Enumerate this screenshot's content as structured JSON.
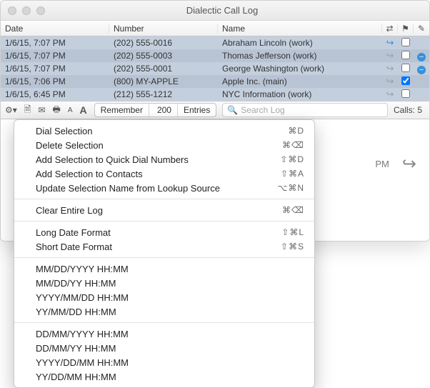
{
  "window": {
    "title": "Dialectic Call Log"
  },
  "columns": {
    "date": "Date",
    "number": "Number",
    "name": "Name"
  },
  "rows": [
    {
      "date": "1/6/15, 7:07 PM",
      "number": "(202) 555-0016",
      "name": "Abraham Lincoln (work)",
      "dir": "in",
      "flag": false,
      "minus": false
    },
    {
      "date": "1/6/15, 7:07 PM",
      "number": "(202) 555-0003",
      "name": "Thomas Jefferson (work)",
      "dir": "out",
      "flag": false,
      "minus": true
    },
    {
      "date": "1/6/15, 7:07 PM",
      "number": "(202) 555-0001",
      "name": "George Washington (work)",
      "dir": "out",
      "flag": false,
      "minus": true
    },
    {
      "date": "1/6/15, 7:06 PM",
      "number": "(800) MY-APPLE",
      "name": "Apple Inc. (main)",
      "dir": "out",
      "flag": true,
      "minus": false
    },
    {
      "date": "1/6/15, 6:45 PM",
      "number": "(212) 555-1212",
      "name": "NYC Information (work)",
      "dir": "out",
      "flag": false,
      "minus": false
    }
  ],
  "toolbar": {
    "remember_label": "Remember",
    "remember_count": "200",
    "entries_label": "Entries",
    "search_placeholder": "Search Log",
    "calls_label": "Calls: 5"
  },
  "preview": {
    "text": "PM"
  },
  "menu": {
    "g1": [
      {
        "label": "Dial Selection",
        "sc": "⌘D"
      },
      {
        "label": "Delete Selection",
        "sc": "⌘⌫"
      },
      {
        "label": "Add Selection to Quick Dial Numbers",
        "sc": "⇧⌘D"
      },
      {
        "label": "Add Selection to Contacts",
        "sc": "⇧⌘A"
      },
      {
        "label": "Update Selection Name from Lookup Source",
        "sc": "⌥⌘N"
      }
    ],
    "g2": [
      {
        "label": "Clear Entire Log",
        "sc": "⌘⌫"
      }
    ],
    "g3": [
      {
        "label": "Long Date Format",
        "sc": "⇧⌘L"
      },
      {
        "label": "Short Date Format",
        "sc": "⇧⌘S"
      }
    ],
    "g4": [
      {
        "label": "MM/DD/YYYY HH:MM"
      },
      {
        "label": "MM/DD/YY HH:MM"
      },
      {
        "label": "YYYY/MM/DD HH:MM"
      },
      {
        "label": "YY/MM/DD HH:MM"
      }
    ],
    "g5": [
      {
        "label": "DD/MM/YYYY HH:MM"
      },
      {
        "label": "DD/MM/YY HH:MM"
      },
      {
        "label": "YYYY/DD/MM HH:MM"
      },
      {
        "label": "YY/DD/MM HH:MM"
      }
    ]
  }
}
